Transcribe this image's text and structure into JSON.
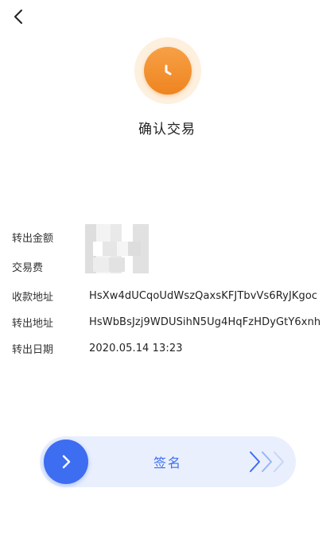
{
  "header": {
    "back_icon": "chevron-left-icon"
  },
  "status": {
    "icon": "clock-icon",
    "color": "#ee8420"
  },
  "title": "确认交易",
  "details": {
    "amount": {
      "label": "转出金额",
      "value": ""
    },
    "fee": {
      "label": "交易费",
      "value": ""
    },
    "to_address": {
      "label": "收款地址",
      "value": "HsXw4dUCqoUdWszQaxsKFJTbvVs6RyJKgoc"
    },
    "from_address": {
      "label": "转出地址",
      "value": "HsWbBsJzj9WDUSihN5Ug4HqFzHDyGtY6xnh"
    },
    "date": {
      "label": "转出日期",
      "value": "2020.05.14 13:23"
    }
  },
  "slider": {
    "label": "签名",
    "thumb_icon": "chevron-right-icon",
    "accent": "#3d6df0"
  }
}
